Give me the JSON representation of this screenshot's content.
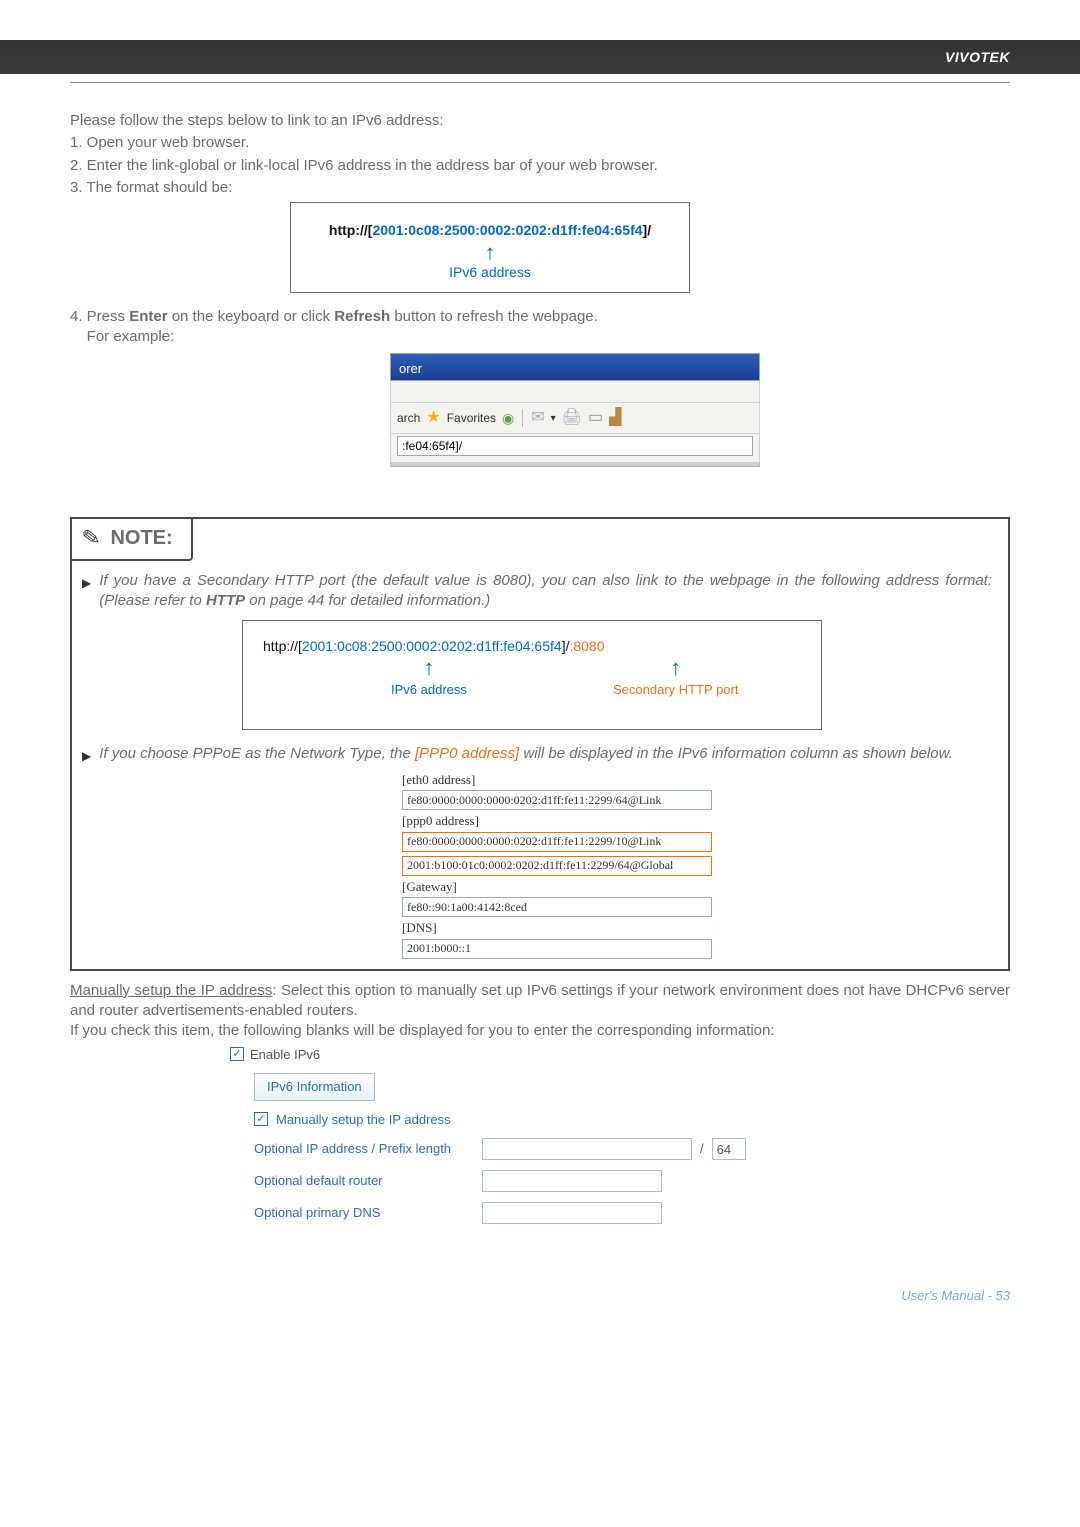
{
  "header": {
    "brand": "VIVOTEK"
  },
  "intro": {
    "lead": "Please follow the steps below to link to an IPv6 address:",
    "step1": "1. Open your web browser.",
    "step2": "2. Enter the link-global or link-local IPv6 address in the address bar of your web browser.",
    "step3": "3. The format should be:"
  },
  "url1": {
    "prefix": "http://",
    "lb": "[",
    "addr": "2001:0c08:2500:0002:0202:d1ff:fe04:65f4",
    "rb": "]",
    "suffix": "/",
    "arrow_label": "IPv6 address"
  },
  "press": {
    "p1a": "4. Press ",
    "p1b": "Enter",
    "p1c": " on the keyboard or click ",
    "p1d": "Refresh",
    "p1e": " button to refresh the webpage.",
    "p2": "    For example:"
  },
  "ie": {
    "title_fragment": "orer",
    "arch": "arch",
    "favorites": "Favorites",
    "address_value": ":fe04:65f4]/"
  },
  "note": {
    "title": "NOTE:",
    "b1a": "If you have a Secondary HTTP port (the default value is 8080), you can also link to the webpage in the following address format: (Please refer to ",
    "b1b": "HTTP",
    "b1c": " on page 44 for detailed information.)",
    "url2": {
      "prefix": "http://",
      "lb": "[",
      "addr": "2001:0c08:2500:0002:0202:d1ff:fe04:65f4",
      "rb": "]",
      "slash": "/",
      "port": ":8080",
      "label_addr": "IPv6 address",
      "label_port": "Secondary HTTP port"
    },
    "b2a": "If you choose PPPoE as the Network Type, the ",
    "b2b": "[PPP0 address]",
    "b2c": " will be displayed in the IPv6 information column as shown below.",
    "info": {
      "eth0_lbl": "[eth0 address]",
      "eth0_val": "fe80:0000:0000:0000:0202:d1ff:fe11:2299/64@Link",
      "ppp0_lbl": "[ppp0 address]",
      "ppp0_val1": "fe80:0000:0000:0000:0202:d1ff:fe11:2299/10@Link",
      "ppp0_val2": "2001:b100:01c0:0002:0202:d1ff:fe11:2299/64@Global",
      "gw_lbl": "[Gateway]",
      "gw_val": "fe80::90:1a00:4142:8ced",
      "dns_lbl": "[DNS]",
      "dns_val": "2001:b000::1"
    }
  },
  "manual": {
    "t1a": "Manually setup the IP address",
    "t1b": ": Select this option to manually set up IPv6 settings if your network environment does not have DHCPv6 server and router advertisements-enabled routers.",
    "t2": "If you check this item, the following blanks will be displayed for you to enter the corresponding information:"
  },
  "cfg": {
    "enable": "Enable IPv6",
    "info_btn": "IPv6 Information",
    "manual_chk": "Manually setup the IP address",
    "opt_ip": "Optional IP address / Prefix length",
    "prefix_value": "64",
    "opt_router": "Optional default router",
    "opt_dns": "Optional primary DNS",
    "slash": "/"
  },
  "footer": {
    "text": "User's Manual - 53"
  }
}
